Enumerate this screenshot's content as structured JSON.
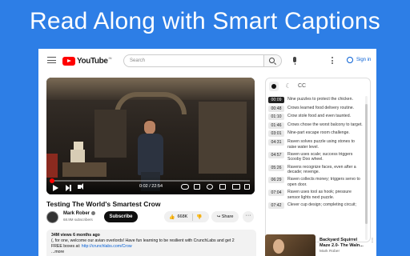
{
  "headline": "Read Along with Smart Captions",
  "topbar": {
    "logo_text": "YouTube",
    "logo_sup": "IN",
    "search_placeholder": "Search",
    "signin_label": "Sign in"
  },
  "video": {
    "time": "0:02 / 22:54",
    "progress_fraction": 0.002
  },
  "meta": {
    "title": "Testing The World's Smartest Crow",
    "channel": "Mark Rober",
    "subscribers": "68.9M subscribers",
    "subscribe_label": "Subscribe",
    "likes": "668K",
    "share_label": "Share",
    "more_label": "···"
  },
  "description": {
    "stats": "34M views  6 months ago",
    "line1": "(, for one, welcome our avian overlords! Have fun learning to be resilient with CrunchLabs and get 2",
    "line2_prefix": "FREE boxes at: ",
    "line2_link": "http://crunchlabs.com/Crow",
    "more_label": "...more"
  },
  "captions": {
    "cc_label": "CC",
    "moon_icon": "☾",
    "entries": [
      {
        "time": "00:09",
        "text": "Nine puzzles to protect the chicken.",
        "active": true
      },
      {
        "time": "00:48",
        "text": "Crows learned food delivery routine.",
        "active": false
      },
      {
        "time": "01:10",
        "text": "Crow stole food and even taunted.",
        "active": false
      },
      {
        "time": "01:46",
        "text": "Crows chose the worst balcony to target.",
        "active": false
      },
      {
        "time": "03:01",
        "text": "Nine-part escape room challenge.",
        "active": false
      },
      {
        "time": "04:31",
        "text": "Raven solves puzzle using stones to raise water level.",
        "active": false
      },
      {
        "time": "04:57",
        "text": "Raven uses scale; success triggers Scooby Doo wheel.",
        "active": false
      },
      {
        "time": "05:26",
        "text": "Ravens recognize faces, even after a decade; revenge.",
        "active": false
      },
      {
        "time": "06:29",
        "text": "Raven collects money; triggers servo to open door.",
        "active": false
      },
      {
        "time": "07:04",
        "text": "Raven uses tool as hook; pressure sensor lights next puzzle.",
        "active": false
      },
      {
        "time": "07:42",
        "text": "Clever cup design; completing circuit;",
        "active": false
      }
    ]
  },
  "recommendation": {
    "title": "Backyard Squirrel Maze 2.0- The Waln...",
    "channel": "Mark Rober"
  }
}
